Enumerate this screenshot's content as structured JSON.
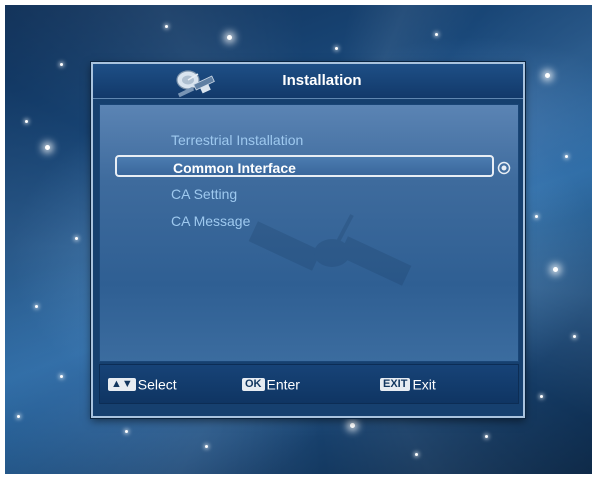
{
  "window": {
    "title": "Installation",
    "title_icon": "satellite-icon"
  },
  "menu": {
    "items": [
      {
        "label": "Terrestrial Installation",
        "selected": false
      },
      {
        "label": "Common Interface",
        "selected": true
      },
      {
        "label": "CA Setting",
        "selected": false
      },
      {
        "label": "CA Message",
        "selected": false
      }
    ],
    "selected_indicator": "radio-selected-icon"
  },
  "hints": {
    "select": {
      "key": "▲▼",
      "label": "Select"
    },
    "enter": {
      "key": "OK",
      "label": "Enter"
    },
    "exit": {
      "key": "EXIT",
      "label": "Exit"
    }
  },
  "colors": {
    "menu_text": "#9ec9ef",
    "selected_text": "#ffffff",
    "panel": "#16406f",
    "highlight_border": "#e8eef5"
  }
}
